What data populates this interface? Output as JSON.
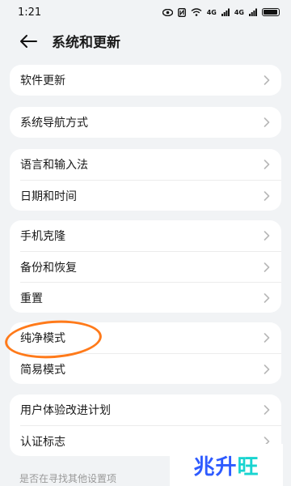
{
  "status": {
    "time": "1:21",
    "signal1": "4G",
    "signal2": "4G"
  },
  "header": {
    "title": "系统和更新"
  },
  "groups": [
    {
      "items": [
        "软件更新"
      ]
    },
    {
      "items": [
        "系统导航方式"
      ]
    },
    {
      "items": [
        "语言和输入法",
        "日期和时间"
      ]
    },
    {
      "items": [
        "手机克隆",
        "备份和恢复",
        "重置"
      ]
    },
    {
      "items": [
        "纯净模式",
        "简易模式"
      ]
    },
    {
      "items": [
        "用户体验改进计划",
        "认证标志"
      ]
    }
  ],
  "bottom_hint": "是否在寻找其他设置项",
  "watermark": {
    "text_a": "兆升",
    "text_b": "旺"
  },
  "colors": {
    "accent_circle": "#ff7a1a",
    "logo_blue": "#2e5bff",
    "logo_cyan": "#18d4d0"
  }
}
